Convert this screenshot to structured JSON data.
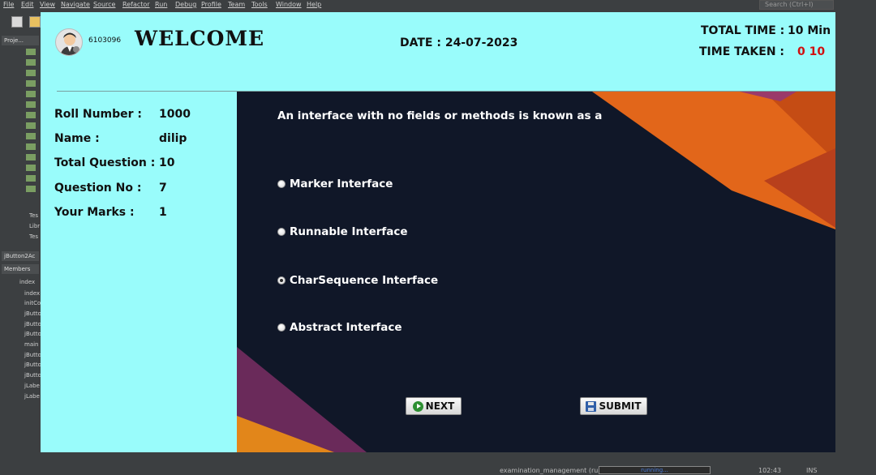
{
  "ide": {
    "menu": [
      "File",
      "Edit",
      "View",
      "Navigate",
      "Source",
      "Refactor",
      "Run",
      "Debug",
      "Profile",
      "Team",
      "Tools",
      "Window",
      "Help"
    ],
    "search_placeholder": "Search (Ctrl+I)",
    "projects_tab": "Proje...",
    "members_panel_title": "jButton2Ac",
    "members_tab": "Members",
    "tree_items": [
      "index",
      "index",
      "initCo",
      "jButto",
      "jButto",
      "jButto",
      "main",
      "jButto",
      "jButto",
      "jButto",
      "jLabe",
      "jLabe"
    ],
    "project_items": [
      "Tes",
      "Libr",
      "Tes"
    ],
    "status": {
      "task": "examination_management (run)",
      "progress_label": "running...",
      "position": "102:43",
      "mode": "INS"
    }
  },
  "exam": {
    "user_id": "6103096",
    "welcome": "WELCOME",
    "date_label": "DATE : 24-07-2023",
    "total_time_label": "TOTAL TIME :",
    "total_time_value": "10 Min",
    "time_taken_label": "TIME TAKEN :",
    "time_taken_value": "0 10",
    "info": [
      {
        "label": "Roll Number :",
        "value": "1000"
      },
      {
        "label": "Name :",
        "value": "dilip"
      },
      {
        "label": "Total Question :",
        "value": "10"
      },
      {
        "label": "Question No :",
        "value": "7"
      },
      {
        "label": "Your Marks :",
        "value": "1"
      }
    ],
    "question": "An interface with no fields or methods is known as a",
    "options": [
      {
        "label": "Marker Interface",
        "checked": false
      },
      {
        "label": "Runnable Interface",
        "checked": false
      },
      {
        "label": "CharSequence Interface",
        "checked": true
      },
      {
        "label": "Abstract Interface",
        "checked": false
      }
    ],
    "next_label": "NEXT",
    "submit_label": "SUBMIT",
    "colors": {
      "panel_bg": "#99fcfb",
      "question_bg": "#101728",
      "accent_orange": "#e2661a",
      "accent_purple": "#6a2a5a",
      "time_taken_red": "#d01010"
    }
  }
}
